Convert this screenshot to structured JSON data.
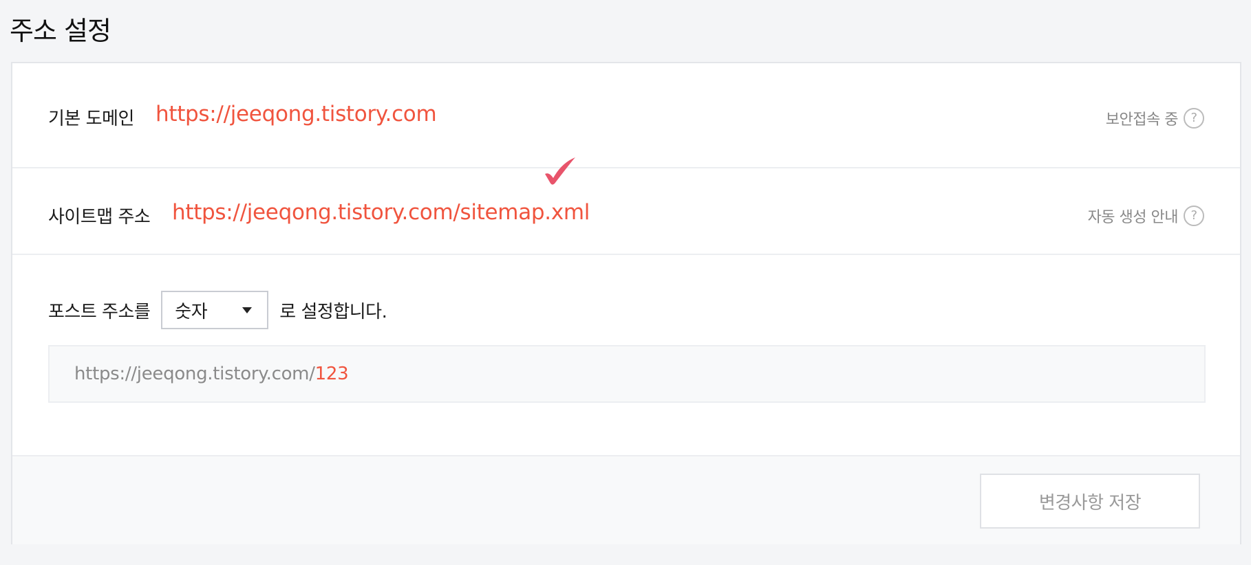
{
  "page": {
    "title": "주소 설정"
  },
  "domain": {
    "label": "기본 도메인",
    "value": "https://jeeqong.tistory.com",
    "help_text": "보안접속 중",
    "help_icon": "?"
  },
  "sitemap": {
    "label": "사이트맵 주소",
    "value": "https://jeeqong.tistory.com/sitemap.xml",
    "help_text": "자동 생성 안내",
    "help_icon": "?"
  },
  "post_address": {
    "prefix_text": "포스트 주소를",
    "select_value": "숫자",
    "suffix_text": "로 설정합니다.",
    "preview_base": "https://jeeqong.tistory.com/",
    "preview_suffix": "123"
  },
  "footer": {
    "save_label": "변경사항 저장"
  },
  "colors": {
    "accent": "#f0543e",
    "check_mark": "#e8546b"
  }
}
